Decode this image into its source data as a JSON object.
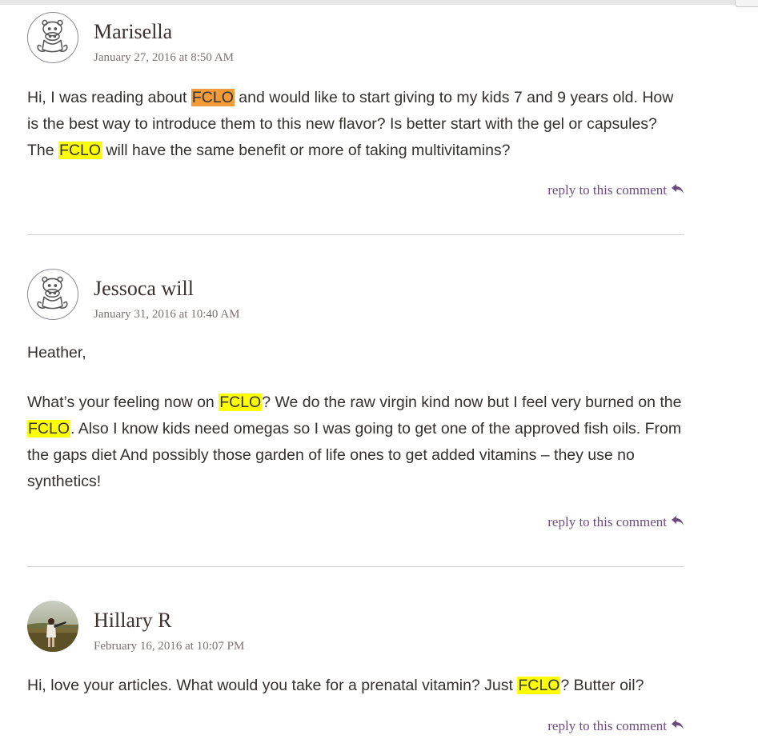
{
  "reply_label": "reply to this comment",
  "icons": {
    "avatar_default": "hippo-avatar-icon",
    "reply": "reply-arrow-icon"
  },
  "colors": {
    "highlight": "#ffff00",
    "highlight_active": "#f39b38",
    "reply_link": "#6b4c7d"
  },
  "comments": [
    {
      "author": "Marisella",
      "date": "January 27, 2016 at 8:50 AM",
      "p1": {
        "t1": "Hi, I was reading about ",
        "h1": "FCLO",
        "t2": " and would like to start giving to my kids 7 and 9 years old. How is the best way to introduce them to this new flavor? Is better start with the gel or capsules? The ",
        "h2": "FCLO",
        "t3": " will have the same benefit or more of taking multivitamins?"
      }
    },
    {
      "author": "Jessoca will",
      "date": "January 31, 2016 at 10:40 AM",
      "p1": "Heather,",
      "p2": {
        "t1": "What’s your feeling now on ",
        "h1": "FCLO",
        "t2": "? We do the raw virgin kind now but I feel very burned on the ",
        "h2": "FCLO",
        "t3": ". Also I know kids need omegas so I was going to get one of the approved fish oils. From the gaps diet And possibly those garden of life ones to get added vitamins – they use no synthetics!"
      }
    },
    {
      "author": "Hillary R",
      "date": "February 16, 2016 at 10:07 PM",
      "p1": {
        "t1": "Hi, love your articles. What would you take for a prenatal vitamin? Just ",
        "h1": "FCLO",
        "t2": "? Butter oil?"
      }
    }
  ]
}
